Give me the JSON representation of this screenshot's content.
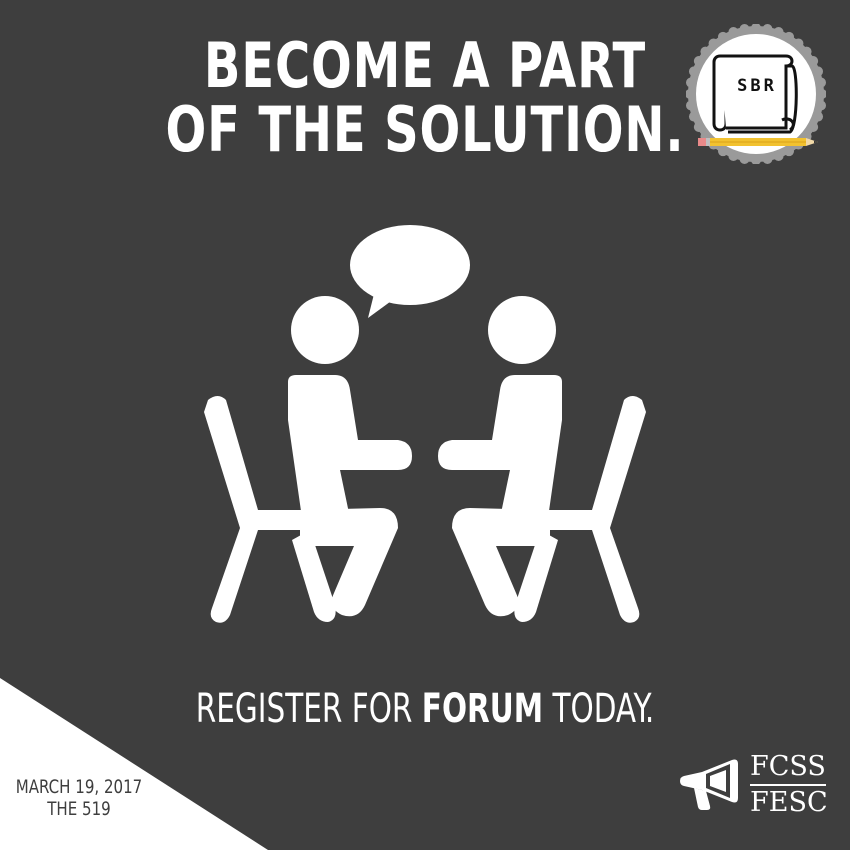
{
  "headline": {
    "line1": "BECOME A PART",
    "line2": "OF THE SOLUTION."
  },
  "badge": {
    "text": "SBR",
    "icon": "scroll-with-pencil-icon"
  },
  "illustration": {
    "icon": "two-people-conversation-icon"
  },
  "register": {
    "before": "REGISTER FOR ",
    "emphasis": "FORUM",
    "after": " TODAY."
  },
  "event": {
    "date": "MARCH 19, 2017",
    "venue": "THE 519"
  },
  "org": {
    "line1": "FCSS",
    "line2": "FESC",
    "icon": "megaphone-icon"
  },
  "colors": {
    "background": "#3e3e3e",
    "foreground": "#ffffff",
    "pencil": "#f2c230",
    "eraser": "#e98a8a"
  }
}
